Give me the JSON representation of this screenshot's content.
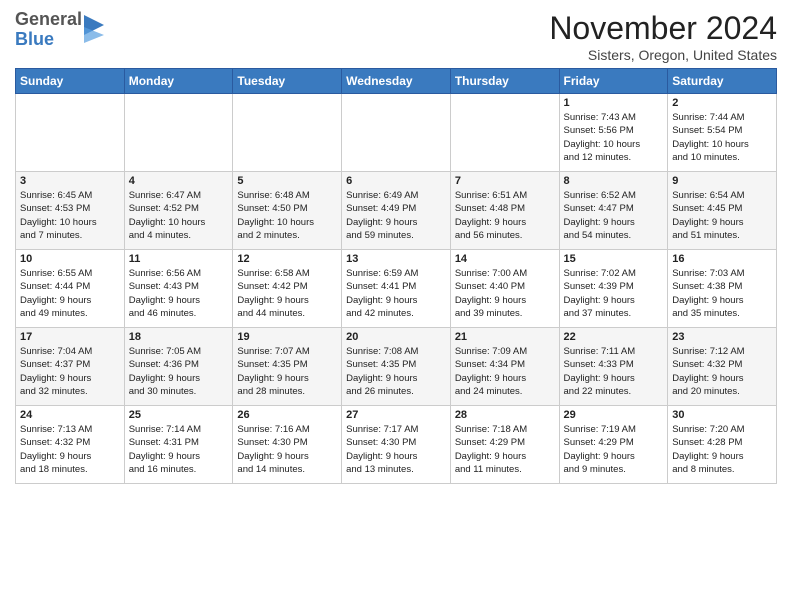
{
  "header": {
    "logo_line1": "General",
    "logo_line2": "Blue",
    "title": "November 2024",
    "location": "Sisters, Oregon, United States"
  },
  "days_of_week": [
    "Sunday",
    "Monday",
    "Tuesday",
    "Wednesday",
    "Thursday",
    "Friday",
    "Saturday"
  ],
  "weeks": [
    [
      {
        "day": "",
        "info": ""
      },
      {
        "day": "",
        "info": ""
      },
      {
        "day": "",
        "info": ""
      },
      {
        "day": "",
        "info": ""
      },
      {
        "day": "",
        "info": ""
      },
      {
        "day": "1",
        "info": "Sunrise: 7:43 AM\nSunset: 5:56 PM\nDaylight: 10 hours\nand 12 minutes."
      },
      {
        "day": "2",
        "info": "Sunrise: 7:44 AM\nSunset: 5:54 PM\nDaylight: 10 hours\nand 10 minutes."
      }
    ],
    [
      {
        "day": "3",
        "info": "Sunrise: 6:45 AM\nSunset: 4:53 PM\nDaylight: 10 hours\nand 7 minutes."
      },
      {
        "day": "4",
        "info": "Sunrise: 6:47 AM\nSunset: 4:52 PM\nDaylight: 10 hours\nand 4 minutes."
      },
      {
        "day": "5",
        "info": "Sunrise: 6:48 AM\nSunset: 4:50 PM\nDaylight: 10 hours\nand 2 minutes."
      },
      {
        "day": "6",
        "info": "Sunrise: 6:49 AM\nSunset: 4:49 PM\nDaylight: 9 hours\nand 59 minutes."
      },
      {
        "day": "7",
        "info": "Sunrise: 6:51 AM\nSunset: 4:48 PM\nDaylight: 9 hours\nand 56 minutes."
      },
      {
        "day": "8",
        "info": "Sunrise: 6:52 AM\nSunset: 4:47 PM\nDaylight: 9 hours\nand 54 minutes."
      },
      {
        "day": "9",
        "info": "Sunrise: 6:54 AM\nSunset: 4:45 PM\nDaylight: 9 hours\nand 51 minutes."
      }
    ],
    [
      {
        "day": "10",
        "info": "Sunrise: 6:55 AM\nSunset: 4:44 PM\nDaylight: 9 hours\nand 49 minutes."
      },
      {
        "day": "11",
        "info": "Sunrise: 6:56 AM\nSunset: 4:43 PM\nDaylight: 9 hours\nand 46 minutes."
      },
      {
        "day": "12",
        "info": "Sunrise: 6:58 AM\nSunset: 4:42 PM\nDaylight: 9 hours\nand 44 minutes."
      },
      {
        "day": "13",
        "info": "Sunrise: 6:59 AM\nSunset: 4:41 PM\nDaylight: 9 hours\nand 42 minutes."
      },
      {
        "day": "14",
        "info": "Sunrise: 7:00 AM\nSunset: 4:40 PM\nDaylight: 9 hours\nand 39 minutes."
      },
      {
        "day": "15",
        "info": "Sunrise: 7:02 AM\nSunset: 4:39 PM\nDaylight: 9 hours\nand 37 minutes."
      },
      {
        "day": "16",
        "info": "Sunrise: 7:03 AM\nSunset: 4:38 PM\nDaylight: 9 hours\nand 35 minutes."
      }
    ],
    [
      {
        "day": "17",
        "info": "Sunrise: 7:04 AM\nSunset: 4:37 PM\nDaylight: 9 hours\nand 32 minutes."
      },
      {
        "day": "18",
        "info": "Sunrise: 7:05 AM\nSunset: 4:36 PM\nDaylight: 9 hours\nand 30 minutes."
      },
      {
        "day": "19",
        "info": "Sunrise: 7:07 AM\nSunset: 4:35 PM\nDaylight: 9 hours\nand 28 minutes."
      },
      {
        "day": "20",
        "info": "Sunrise: 7:08 AM\nSunset: 4:35 PM\nDaylight: 9 hours\nand 26 minutes."
      },
      {
        "day": "21",
        "info": "Sunrise: 7:09 AM\nSunset: 4:34 PM\nDaylight: 9 hours\nand 24 minutes."
      },
      {
        "day": "22",
        "info": "Sunrise: 7:11 AM\nSunset: 4:33 PM\nDaylight: 9 hours\nand 22 minutes."
      },
      {
        "day": "23",
        "info": "Sunrise: 7:12 AM\nSunset: 4:32 PM\nDaylight: 9 hours\nand 20 minutes."
      }
    ],
    [
      {
        "day": "24",
        "info": "Sunrise: 7:13 AM\nSunset: 4:32 PM\nDaylight: 9 hours\nand 18 minutes."
      },
      {
        "day": "25",
        "info": "Sunrise: 7:14 AM\nSunset: 4:31 PM\nDaylight: 9 hours\nand 16 minutes."
      },
      {
        "day": "26",
        "info": "Sunrise: 7:16 AM\nSunset: 4:30 PM\nDaylight: 9 hours\nand 14 minutes."
      },
      {
        "day": "27",
        "info": "Sunrise: 7:17 AM\nSunset: 4:30 PM\nDaylight: 9 hours\nand 13 minutes."
      },
      {
        "day": "28",
        "info": "Sunrise: 7:18 AM\nSunset: 4:29 PM\nDaylight: 9 hours\nand 11 minutes."
      },
      {
        "day": "29",
        "info": "Sunrise: 7:19 AM\nSunset: 4:29 PM\nDaylight: 9 hours\nand 9 minutes."
      },
      {
        "day": "30",
        "info": "Sunrise: 7:20 AM\nSunset: 4:28 PM\nDaylight: 9 hours\nand 8 minutes."
      }
    ]
  ]
}
